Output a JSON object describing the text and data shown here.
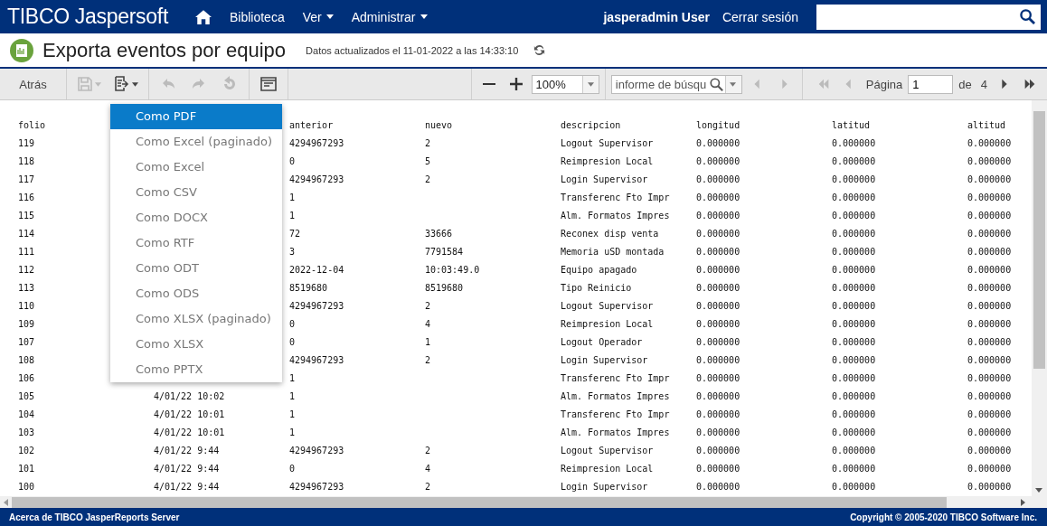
{
  "header": {
    "logo": "TIBCO Jaspersoft",
    "nav": [
      {
        "label": "Biblioteca",
        "dropdown": false
      },
      {
        "label": "Ver",
        "dropdown": true
      },
      {
        "label": "Administrar",
        "dropdown": true
      }
    ],
    "user": "jasperadmin User",
    "logout": "Cerrar sesión"
  },
  "title_bar": {
    "title": "Exporta eventos por equipo",
    "updated": "Datos actualizados el 11-01-2022 a las 14:33:10"
  },
  "toolbar": {
    "back": "Atrás",
    "tools": [
      {
        "kind": "save",
        "disabled": true
      },
      {
        "kind": "export",
        "disabled": false
      },
      {
        "kind": "undo",
        "disabled": true
      },
      {
        "kind": "redo",
        "disabled": true
      },
      {
        "kind": "undo_all",
        "disabled": true
      },
      {
        "kind": "layout",
        "disabled": false
      }
    ],
    "zoom": "100%",
    "search_placeholder": "informe de búsqu",
    "search_nav": [
      {
        "kind": "prev",
        "disabled": true
      },
      {
        "kind": "next",
        "disabled": true
      }
    ],
    "pager": [
      {
        "kind": "first",
        "disabled": true
      },
      {
        "kind": "prev",
        "disabled": true
      }
    ],
    "page_label": "Página",
    "page": "1",
    "of_label": "de",
    "total": "4",
    "pager_end": [
      {
        "kind": "next",
        "disabled": false
      },
      {
        "kind": "last",
        "disabled": false
      }
    ]
  },
  "export_menu": [
    {
      "label": "Como PDF",
      "selected": true
    },
    {
      "label": "Como Excel (paginado)",
      "selected": false
    },
    {
      "label": "Como Excel",
      "selected": false
    },
    {
      "label": "Como CSV",
      "selected": false
    },
    {
      "label": "Como DOCX",
      "selected": false
    },
    {
      "label": "Como RTF",
      "selected": false
    },
    {
      "label": "Como ODT",
      "selected": false
    },
    {
      "label": "Como ODS",
      "selected": false
    },
    {
      "label": "Como XLSX (paginado)",
      "selected": false
    },
    {
      "label": "Como XLSX",
      "selected": false
    },
    {
      "label": "Como PPTX",
      "selected": false
    }
  ],
  "table": {
    "columns": [
      "folio",
      null,
      "anterior",
      "nuevo",
      "descripcion",
      "longitud",
      "latitud",
      "altitud"
    ],
    "rows": [
      [
        "119",
        null,
        "4294967293",
        "2",
        "Logout Supervisor",
        "0.000000",
        "0.000000",
        "0.000000"
      ],
      [
        "118",
        null,
        "0",
        "5",
        "Reimpresion Local",
        "0.000000",
        "0.000000",
        "0.000000"
      ],
      [
        "117",
        null,
        "4294967293",
        "2",
        "Login Supervisor",
        "0.000000",
        "0.000000",
        "0.000000"
      ],
      [
        "116",
        null,
        "1",
        null,
        "Transferenc Fto Impr",
        "0.000000",
        "0.000000",
        "0.000000"
      ],
      [
        "115",
        null,
        "1",
        null,
        "Alm. Formatos Impres",
        "0.000000",
        "0.000000",
        "0.000000"
      ],
      [
        "114",
        null,
        "72",
        "33666",
        "Reconex disp venta",
        "0.000000",
        "0.000000",
        "0.000000"
      ],
      [
        "111",
        null,
        "3",
        "7791584",
        "Memoria uSD montada",
        "0.000000",
        "0.000000",
        "0.000000"
      ],
      [
        "112",
        null,
        "2022-12-04",
        "10:03:49.0",
        "Equipo apagado",
        "0.000000",
        "0.000000",
        "0.000000"
      ],
      [
        "113",
        null,
        "8519680",
        "8519680",
        "Tipo Reinicio",
        "0.000000",
        "0.000000",
        "0.000000"
      ],
      [
        "110",
        null,
        "4294967293",
        "2",
        "Logout Supervisor",
        "0.000000",
        "0.000000",
        "0.000000"
      ],
      [
        "109",
        null,
        "0",
        "4",
        "Reimpresion Local",
        "0.000000",
        "0.000000",
        "0.000000"
      ],
      [
        "107",
        null,
        "0",
        "1",
        "Logout Operador",
        "0.000000",
        "0.000000",
        "0.000000"
      ],
      [
        "108",
        null,
        "4294967293",
        "2",
        "Login Supervisor",
        "0.000000",
        "0.000000",
        "0.000000"
      ],
      [
        "106",
        null,
        "1",
        null,
        "Transferenc Fto Impr",
        "0.000000",
        "0.000000",
        "0.000000"
      ],
      [
        "105",
        "4/01/22 10:02",
        "1",
        null,
        "Alm. Formatos Impres",
        "0.000000",
        "0.000000",
        "0.000000"
      ],
      [
        "104",
        "4/01/22 10:01",
        "1",
        null,
        "Transferenc Fto Impr",
        "0.000000",
        "0.000000",
        "0.000000"
      ],
      [
        "103",
        "4/01/22 10:01",
        "1",
        null,
        "Alm. Formatos Impres",
        "0.000000",
        "0.000000",
        "0.000000"
      ],
      [
        "102",
        "4/01/22 9:44",
        "4294967293",
        "2",
        "Logout Supervisor",
        "0.000000",
        "0.000000",
        "0.000000"
      ],
      [
        "101",
        "4/01/22 9:44",
        "0",
        "4",
        "Reimpresion Local",
        "0.000000",
        "0.000000",
        "0.000000"
      ],
      [
        "100",
        "4/01/22 9:44",
        "4294967293",
        "2",
        "Login Supervisor",
        "0.000000",
        "0.000000",
        "0.000000"
      ]
    ]
  },
  "footer": {
    "about": "Acerca de TIBCO JasperReports Server",
    "copyright": "Copyright © 2005-2020 TIBCO Software Inc."
  }
}
